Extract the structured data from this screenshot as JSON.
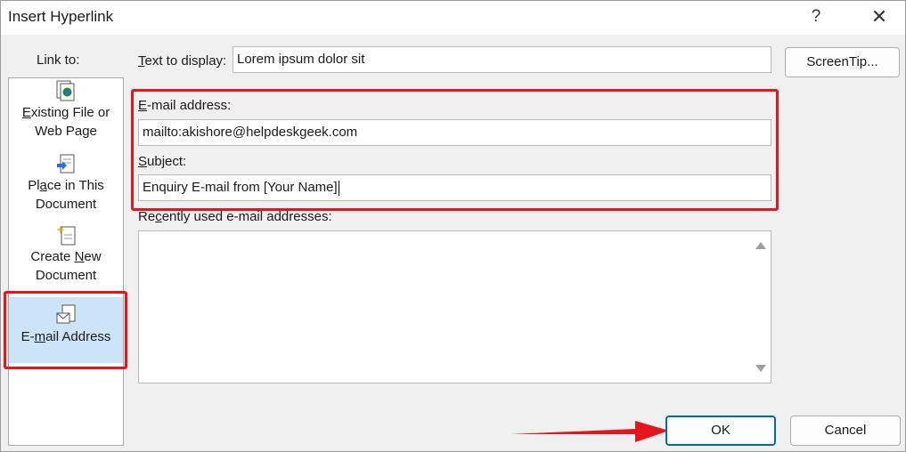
{
  "dialog": {
    "title": "Insert Hyperlink",
    "help_label": "?",
    "close_label": "✕"
  },
  "link_to": {
    "label": "Link to:",
    "items": [
      {
        "line1": "Existing File or",
        "line2": "Web Page",
        "icon": "web-page-icon"
      },
      {
        "line1": "Place in This",
        "line2": "Document",
        "icon": "place-in-document-icon"
      },
      {
        "line1": "Create New",
        "line2": "Document",
        "icon": "new-document-icon"
      },
      {
        "line1": "E-mail Address",
        "line2": "",
        "icon": "email-address-icon",
        "selected": true
      }
    ]
  },
  "fields": {
    "text_display_label": "Text to display:",
    "text_display_value": "Lorem ipsum dolor sit",
    "screentip_label": "ScreenTip...",
    "email_label": "E-mail address:",
    "email_value": "mailto:akishore@helpdeskgeek.com",
    "subject_label": "Subject:",
    "subject_value": "Enquiry E-mail from [Your Name]",
    "recent_label": "Recently used e-mail addresses:"
  },
  "buttons": {
    "ok_label": "OK",
    "cancel_label": "Cancel"
  },
  "colors": {
    "highlight_red": "#e8141c",
    "selection_blue": "#cce4f7",
    "default_button_border": "#0067c0"
  }
}
